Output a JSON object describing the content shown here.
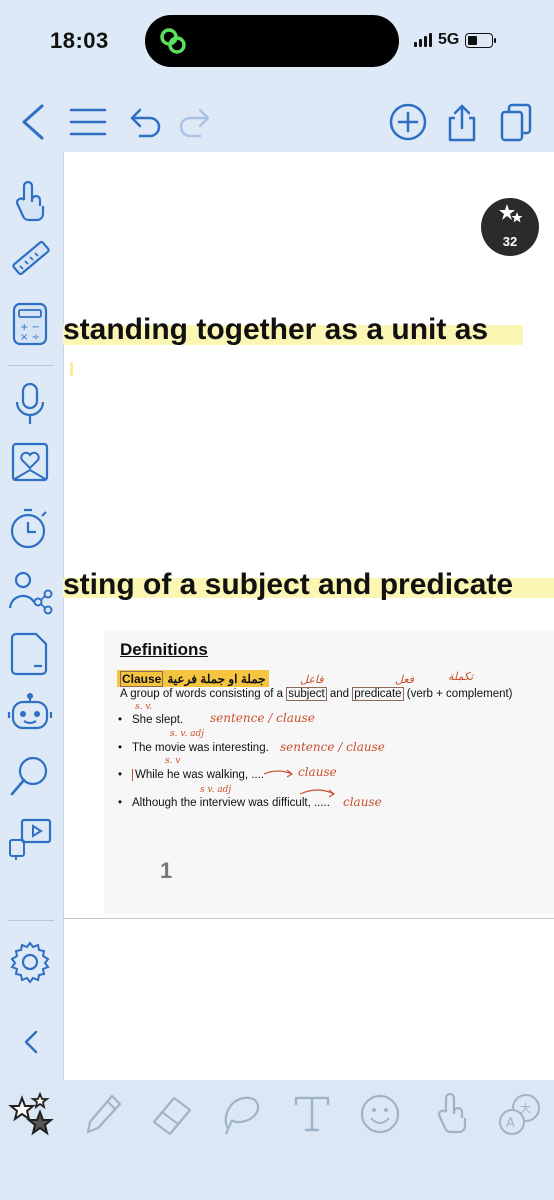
{
  "status": {
    "time": "18:03",
    "network": "5G"
  },
  "toolbar": {
    "icons": [
      "back-icon",
      "menu-icon",
      "undo-icon",
      "redo-icon",
      "add-icon",
      "share-icon",
      "pages-icon"
    ]
  },
  "badge": {
    "count": "32"
  },
  "document": {
    "line1": "standing together as a unit as",
    "line2": "sting of a subject and predicate"
  },
  "slide": {
    "title": "Definitions",
    "clause_label": "Clause",
    "clause_arabic": "جملة او جملة فرعية",
    "definition_prefix": "A group of words consisting of a ",
    "definition_subject": "subject",
    "definition_and": " and ",
    "definition_predicate": "predicate",
    "definition_suffix": " (verb + complement)",
    "bullets": [
      "She slept.",
      "The movie was interesting.",
      "While he was walking, ....",
      "Although the interview was difficult, ....."
    ],
    "page_number": "1"
  },
  "annotations": {
    "a1": "sentence / clause",
    "a2": "sentence / clause",
    "a3": "clause",
    "a4": "clause",
    "s_v_1": "s.   v.",
    "s_v_2": "s.     v.    adj",
    "s_v_3": "s.     v",
    "s_v_4": "s        v.    adj"
  },
  "colors": {
    "accent": "#2f6fc4",
    "highlight_yellow": "#fbf6b3",
    "clause_orange": "#f5c542",
    "ink_red": "#c8502e"
  }
}
